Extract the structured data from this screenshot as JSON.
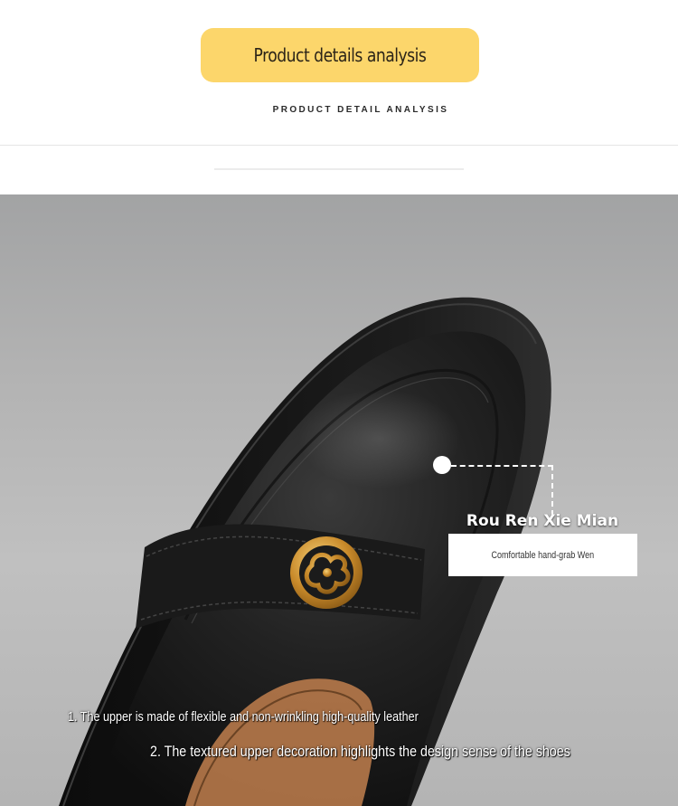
{
  "header": {
    "title": "Product details analysis",
    "subtitle": "PRODUCT DETAIL ANALYSIS",
    "accent_color": "#fcd66b"
  },
  "detail": {
    "image_subject": "black leather loafer toe with gold flower buckle",
    "callout_title": "Rou Ren Xie Mian",
    "callout_text": "Comfortable hand-grab Wen"
  },
  "captions": [
    "1. The upper is made of flexible and non-wrinkling high-quality leather",
    "2. The textured upper decoration highlights the design sense of the shoes"
  ]
}
